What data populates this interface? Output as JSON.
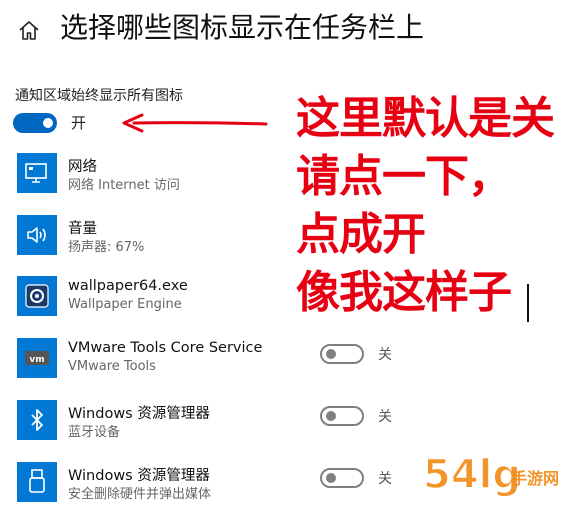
{
  "header": {
    "title": "选择哪些图标显示在任务栏上",
    "home_icon": "home-icon"
  },
  "master": {
    "label": "通知区域始终显示所有图标",
    "state": "开",
    "on": true,
    "accent": "#0067c0"
  },
  "apps": [
    {
      "name": "网络",
      "subtitle": "网络 Internet 访问",
      "icon": "network-icon"
    },
    {
      "name": "音量",
      "subtitle": "扬声器: 67%",
      "icon": "volume-icon"
    },
    {
      "name": "wallpaper64.exe",
      "subtitle": "Wallpaper Engine",
      "icon": "wallpaper-engine-icon"
    },
    {
      "name": "VMware Tools Core Service",
      "subtitle": "VMware Tools",
      "icon": "vmware-icon",
      "state": "关"
    },
    {
      "name": "Windows 资源管理器",
      "subtitle": "蓝牙设备",
      "icon": "bluetooth-icon",
      "state": "关"
    },
    {
      "name": "Windows 资源管理器",
      "subtitle": "安全删除硬件并弹出媒体",
      "icon": "usb-icon",
      "state": "关"
    }
  ],
  "annotation": {
    "lines": [
      "这里默认是关",
      "请点一下，",
      "点成开",
      "像我这样子"
    ],
    "color": "#e60012"
  },
  "watermark": {
    "text": "54lg手游网"
  }
}
